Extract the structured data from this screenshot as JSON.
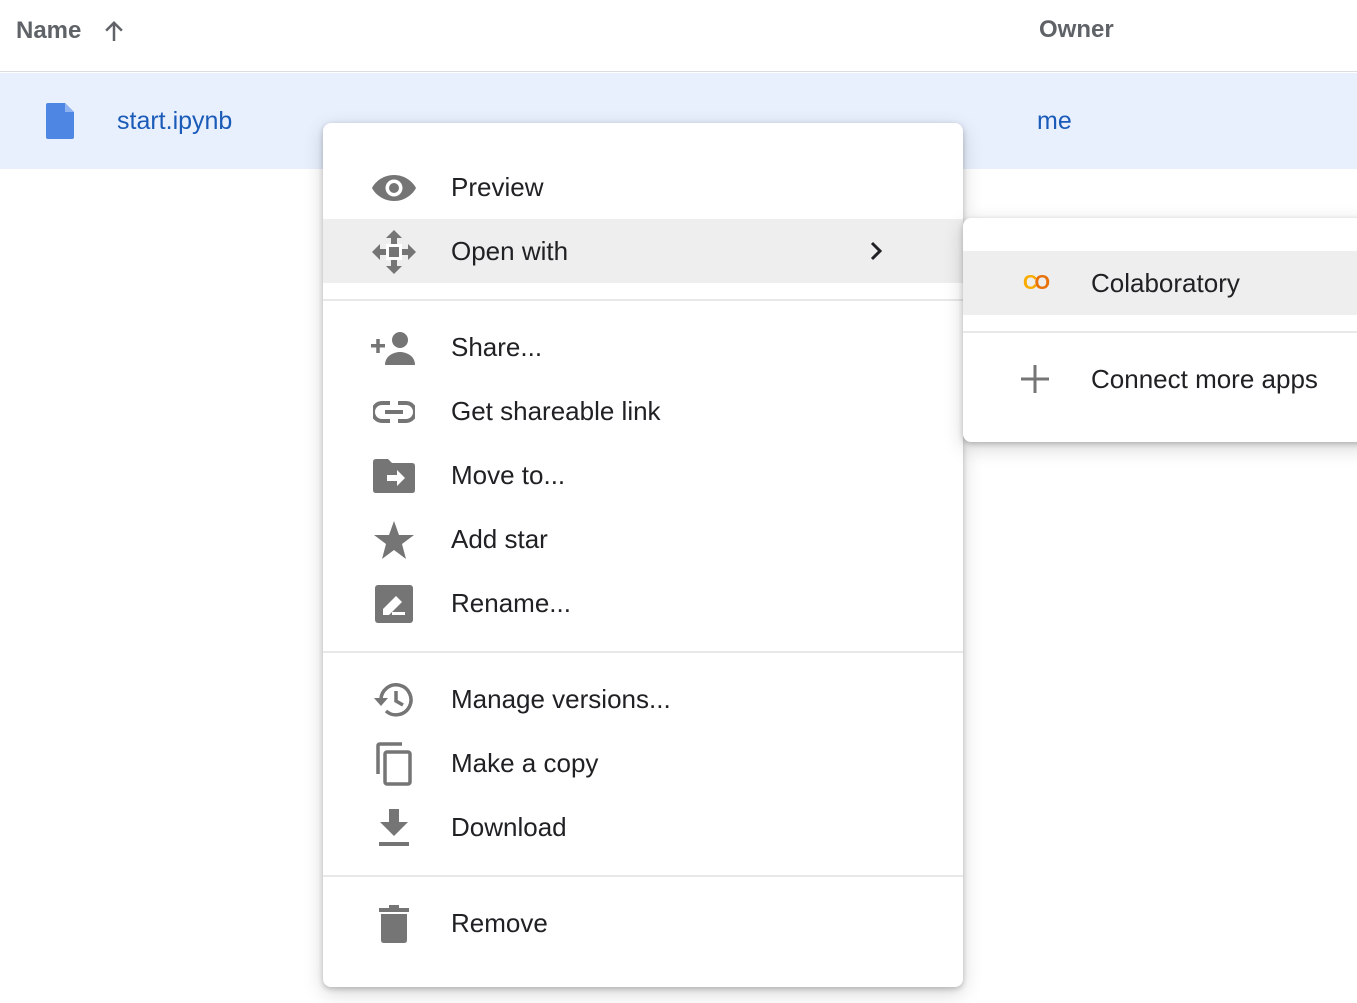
{
  "header": {
    "name_label": "Name",
    "owner_label": "Owner",
    "sort_icon": "arrow-up-icon"
  },
  "file": {
    "name": "start.ipynb",
    "owner": "me",
    "icon": "document-icon"
  },
  "context_menu": {
    "items": [
      {
        "label": "Preview",
        "icon": "eye-icon"
      },
      {
        "label": "Open with",
        "icon": "move-arrows-icon",
        "active": true
      },
      {
        "label": "Share...",
        "icon": "person-add-icon"
      },
      {
        "label": "Get shareable link",
        "icon": "link-icon"
      },
      {
        "label": "Move to...",
        "icon": "folder-move-icon"
      },
      {
        "label": "Add star",
        "icon": "star-icon"
      },
      {
        "label": "Rename...",
        "icon": "edit-icon"
      },
      {
        "label": "Manage versions...",
        "icon": "history-icon"
      },
      {
        "label": "Make a copy",
        "icon": "copy-icon"
      },
      {
        "label": "Download",
        "icon": "download-icon"
      },
      {
        "label": "Remove",
        "icon": "trash-icon"
      }
    ]
  },
  "open_with_submenu": {
    "items": [
      {
        "label": "Colaboratory",
        "icon": "colab-icon",
        "icon_text": "CO",
        "active": true
      },
      {
        "label": "Connect more apps",
        "icon": "plus-icon"
      }
    ]
  },
  "colors": {
    "selected_row": "#e8f0fe",
    "link_blue": "#1a5bb8",
    "file_icon_blue": "#4e86e4",
    "icon_gray": "#757575",
    "hover_gray": "#eeeeee",
    "colab_yellow": "#f9ab00",
    "colab_orange": "#e8710a"
  }
}
